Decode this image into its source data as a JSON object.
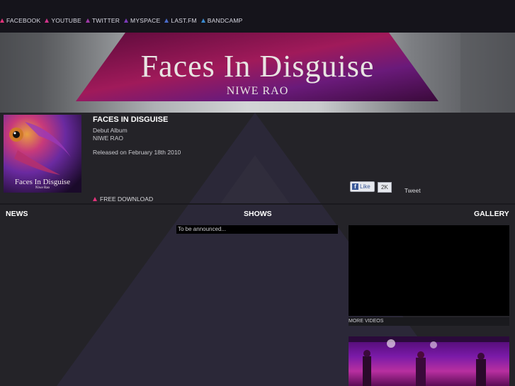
{
  "social": [
    {
      "label": "FACEBOOK",
      "color": "#e0337a"
    },
    {
      "label": "YOUTUBE",
      "color": "#d0338a"
    },
    {
      "label": "TWITTER",
      "color": "#a03aa8"
    },
    {
      "label": "MYSPACE",
      "color": "#7a3ab8"
    },
    {
      "label": "LAST.FM",
      "color": "#4a6ac8"
    },
    {
      "label": "BANDCAMP",
      "color": "#3a8ad0"
    }
  ],
  "banner": {
    "title": "Faces In Disguise",
    "subtitle": "NIWE RAO"
  },
  "cover": {
    "title": "Faces In Disguise",
    "subtitle": "Niwe Rao"
  },
  "album": {
    "title": "FACES IN DISGUISE",
    "type": "Debut Album",
    "artist": "NIWE RAO",
    "released": "Released on February 18th 2010",
    "download": "FREE DOWNLOAD"
  },
  "social_widgets": {
    "like_label": "Like",
    "like_count": "2K",
    "tweet_label": "Tweet"
  },
  "sections": {
    "news": "NEWS",
    "shows": "SHOWS",
    "gallery": "GALLERY"
  },
  "shows": {
    "first": "To be announced..."
  },
  "gallery": {
    "more_videos": "MORE VIDEOS"
  },
  "colors": {
    "accent": "#e0337a",
    "background": "#242328",
    "topbar": "#15141b"
  }
}
